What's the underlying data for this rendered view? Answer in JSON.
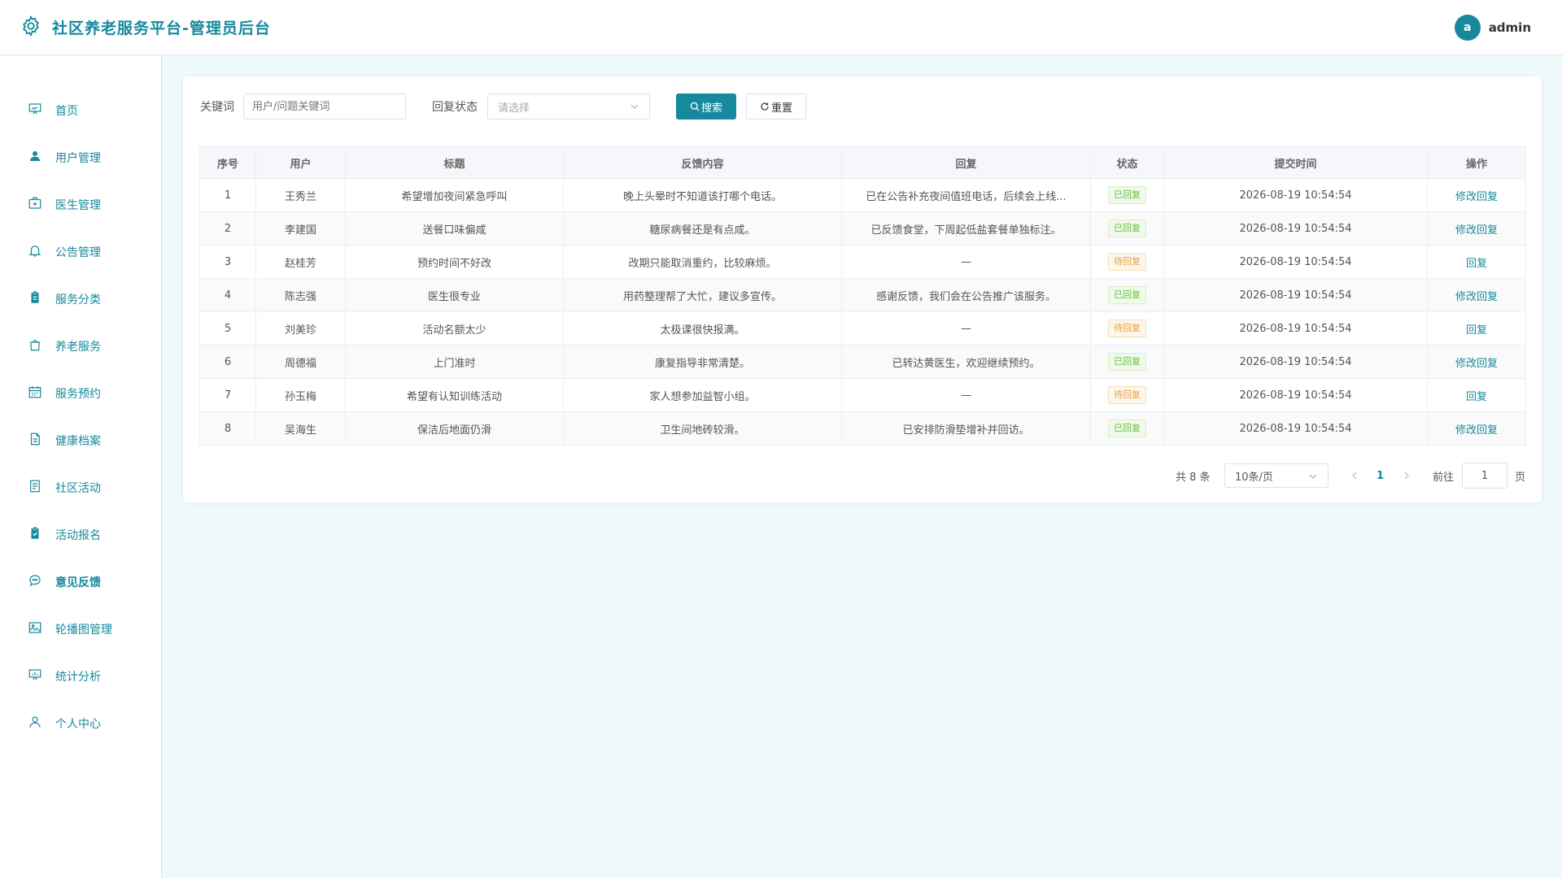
{
  "app": {
    "title": "社区养老服务平台-管理员后台"
  },
  "user": {
    "avatar_letter": "a",
    "name": "admin"
  },
  "colors": {
    "accent": "#16899e",
    "replied": "#67c23a",
    "pending": "#e6a23c"
  },
  "sidebar": {
    "items": [
      {
        "label": "首页",
        "icon": "dashboard-icon"
      },
      {
        "label": "用户管理",
        "icon": "user-icon"
      },
      {
        "label": "医生管理",
        "icon": "medical-box-icon"
      },
      {
        "label": "公告管理",
        "icon": "bell-icon"
      },
      {
        "label": "服务分类",
        "icon": "clipboard-icon"
      },
      {
        "label": "养老服务",
        "icon": "shopping-bag-icon"
      },
      {
        "label": "服务预约",
        "icon": "calendar-icon"
      },
      {
        "label": "健康档案",
        "icon": "document-icon"
      },
      {
        "label": "社区活动",
        "icon": "list-doc-icon"
      },
      {
        "label": "活动报名",
        "icon": "check-clipboard-icon"
      },
      {
        "label": "意见反馈",
        "icon": "chat-bubble-icon",
        "active": true
      },
      {
        "label": "轮播图管理",
        "icon": "image-icon"
      },
      {
        "label": "统计分析",
        "icon": "chart-icon"
      },
      {
        "label": "个人中心",
        "icon": "person-outline-icon"
      }
    ]
  },
  "filter": {
    "keyword_label": "关键词",
    "keyword_placeholder": "用户/问题关键词",
    "status_label": "回复状态",
    "status_placeholder": "请选择",
    "search_label": "搜索",
    "reset_label": "重置"
  },
  "table": {
    "headers": [
      "序号",
      "用户",
      "标题",
      "反馈内容",
      "回复",
      "状态",
      "提交时间",
      "操作"
    ],
    "rows": [
      {
        "no": "1",
        "user": "王秀兰",
        "title": "希望增加夜间紧急呼叫",
        "content": "晚上头晕时不知道该打哪个电话。",
        "reply": "已在公告补充夜间值班电话，后续会上线...",
        "status": "已回复",
        "status_type": "done",
        "time": "2026-08-19 10:54:54",
        "action": "修改回复"
      },
      {
        "no": "2",
        "user": "李建国",
        "title": "送餐口味偏咸",
        "content": "糖尿病餐还是有点咸。",
        "reply": "已反馈食堂，下周起低盐套餐单独标注。",
        "status": "已回复",
        "status_type": "done",
        "time": "2026-08-19 10:54:54",
        "action": "修改回复"
      },
      {
        "no": "3",
        "user": "赵桂芳",
        "title": "预约时间不好改",
        "content": "改期只能取消重约，比较麻烦。",
        "reply": "—",
        "status": "待回复",
        "status_type": "pending",
        "time": "2026-08-19 10:54:54",
        "action": "回复"
      },
      {
        "no": "4",
        "user": "陈志强",
        "title": "医生很专业",
        "content": "用药整理帮了大忙，建议多宣传。",
        "reply": "感谢反馈，我们会在公告推广该服务。",
        "status": "已回复",
        "status_type": "done",
        "time": "2026-08-19 10:54:54",
        "action": "修改回复"
      },
      {
        "no": "5",
        "user": "刘美珍",
        "title": "活动名额太少",
        "content": "太极课很快报满。",
        "reply": "—",
        "status": "待回复",
        "status_type": "pending",
        "time": "2026-08-19 10:54:54",
        "action": "回复"
      },
      {
        "no": "6",
        "user": "周德福",
        "title": "上门准时",
        "content": "康复指导非常清楚。",
        "reply": "已转达黄医生，欢迎继续预约。",
        "status": "已回复",
        "status_type": "done",
        "time": "2026-08-19 10:54:54",
        "action": "修改回复"
      },
      {
        "no": "7",
        "user": "孙玉梅",
        "title": "希望有认知训练活动",
        "content": "家人想参加益智小组。",
        "reply": "—",
        "status": "待回复",
        "status_type": "pending",
        "time": "2026-08-19 10:54:54",
        "action": "回复"
      },
      {
        "no": "8",
        "user": "吴海生",
        "title": "保洁后地面仍滑",
        "content": "卫生间地砖较滑。",
        "reply": "已安排防滑垫增补并回访。",
        "status": "已回复",
        "status_type": "done",
        "time": "2026-08-19 10:54:54",
        "action": "修改回复"
      }
    ]
  },
  "pagination": {
    "total_text": "共 8 条",
    "page_size": "10条/页",
    "current_page": "1",
    "goto_label": "前往",
    "goto_value": "1",
    "page_suffix": "页"
  }
}
